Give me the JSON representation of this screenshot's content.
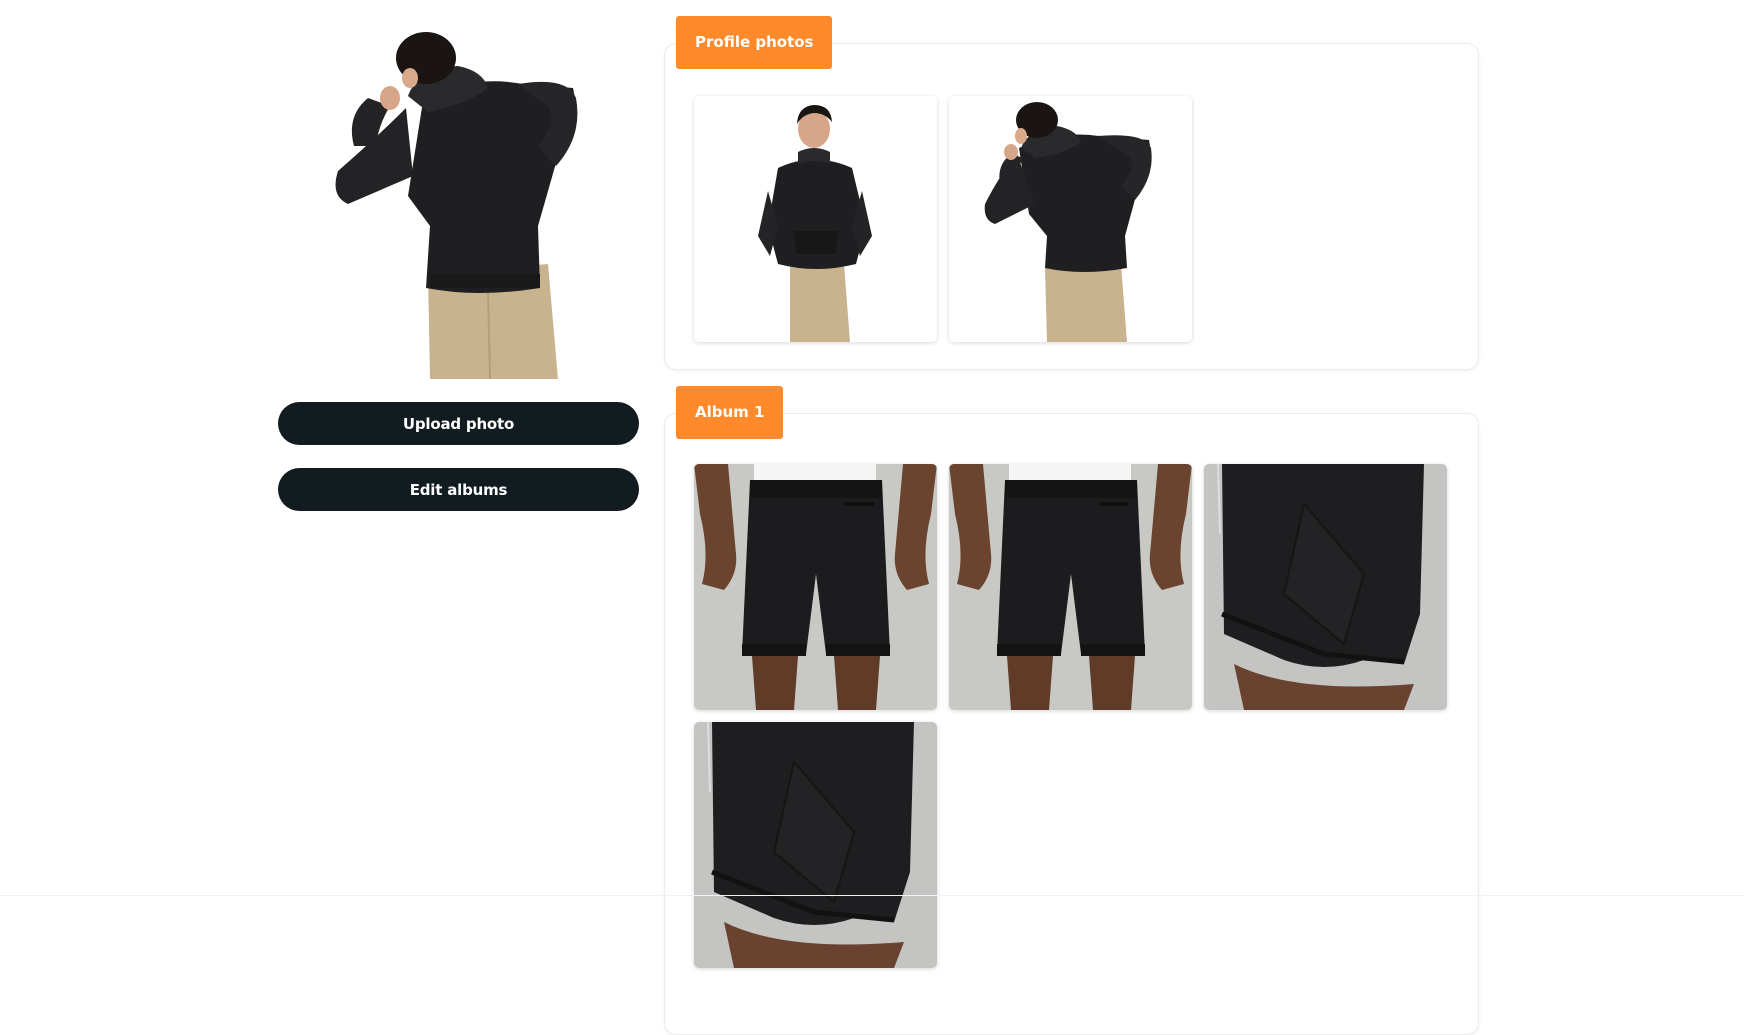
{
  "profile": {
    "photo_icon": "person-back-hoodie-photo"
  },
  "actions": {
    "upload_label": "Upload photo",
    "edit_label": "Edit albums"
  },
  "sections": {
    "profile_photos": {
      "title": "Profile photos",
      "photos": [
        "hoodie-front-photo",
        "hoodie-back-photo"
      ]
    },
    "album_1": {
      "title": "Album 1",
      "photos": [
        "shorts-back-photo",
        "shorts-back-photo",
        "shorts-side-closeup-photo",
        "shorts-side-closeup-photo"
      ]
    }
  },
  "colors": {
    "accent": "#ff8a2b",
    "button_bg": "#121c20",
    "garment": "#1f1f21",
    "pants": "#c8b28e",
    "photo_bg": "#c9c9c6"
  }
}
